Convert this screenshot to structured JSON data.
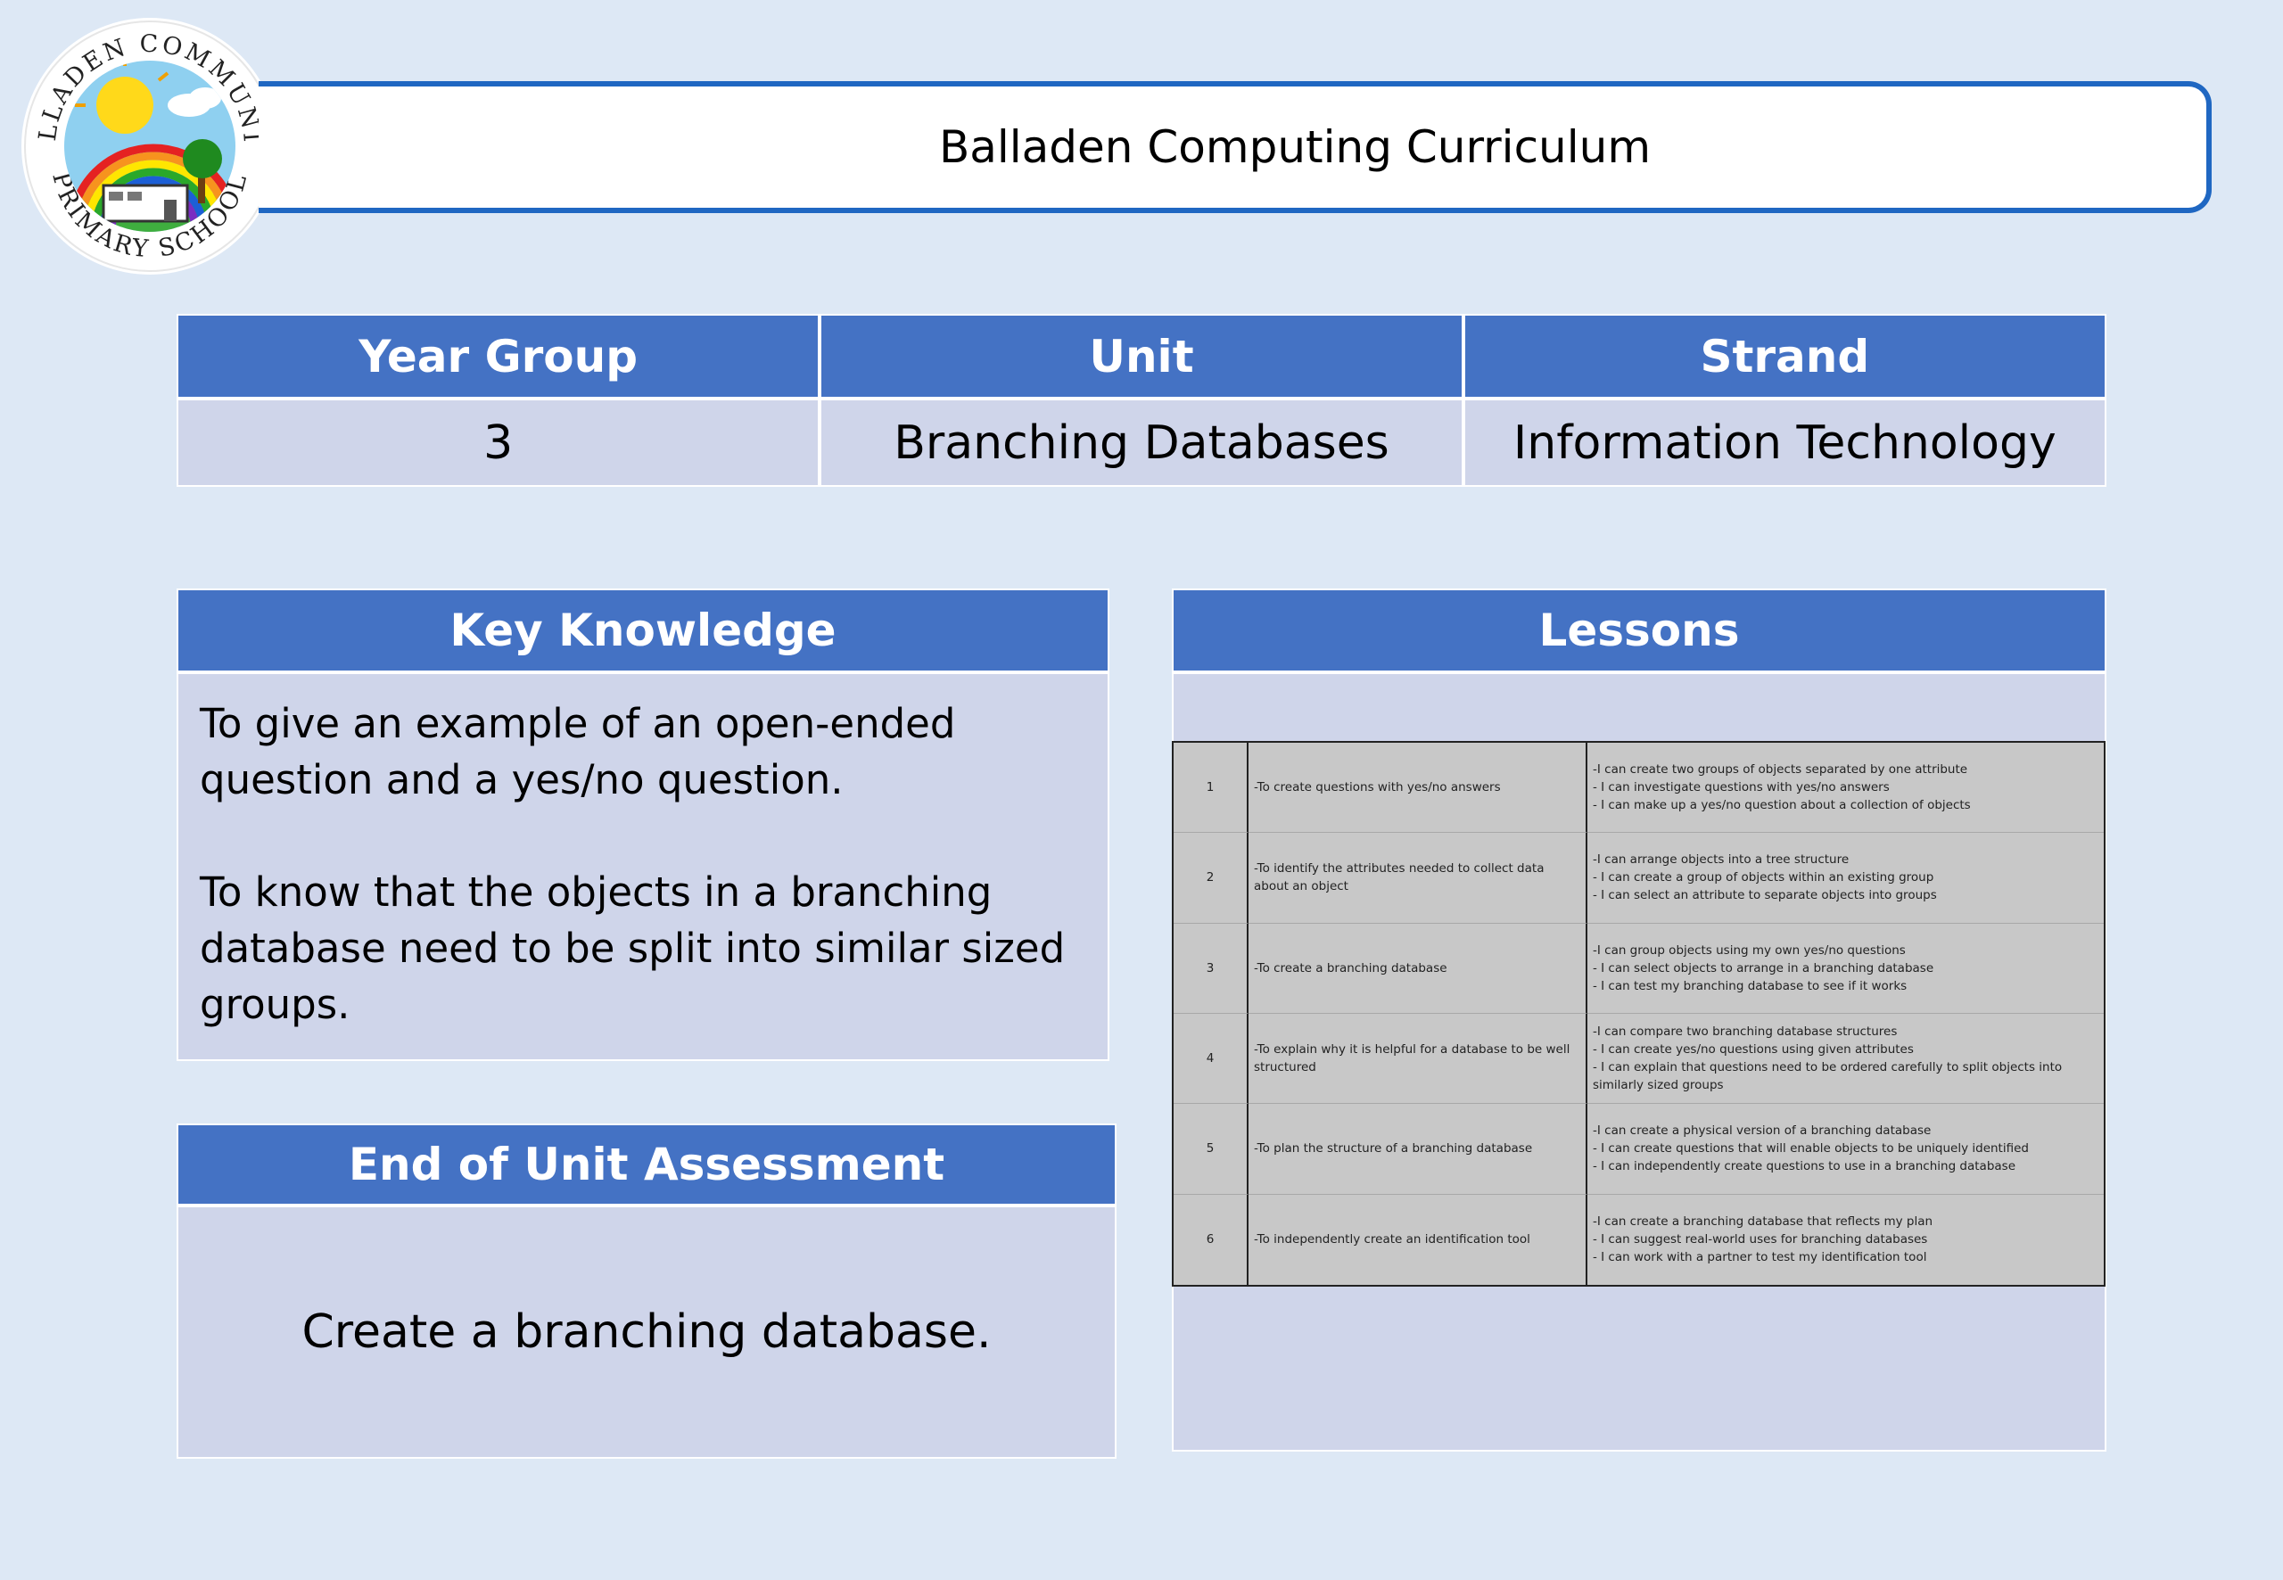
{
  "logo": {
    "arc_text_top": "BALLADEN COMMUNITY",
    "arc_text_bottom": "PRIMARY SCHOOL"
  },
  "title": "Balladen Computing Curriculum",
  "info_table": {
    "headers": [
      "Year Group",
      "Unit",
      "Strand"
    ],
    "values": [
      "3",
      "Branching Databases",
      "Information Technology"
    ]
  },
  "key_knowledge": {
    "heading": "Key Knowledge",
    "paragraphs": [
      "To give an example of an open-ended question and a yes/no question.",
      "To know that the objects in a branching database need to be split into similar sized groups."
    ]
  },
  "assessment": {
    "heading": "End of Unit Assessment",
    "text": "Create a branching database."
  },
  "lessons": {
    "heading": "Lessons",
    "rows": [
      {
        "num": "1",
        "objective": "-To create questions with yes/no answers",
        "outcomes": [
          "-I can create two groups of objects separated by one attribute",
          "- I can investigate questions with yes/no answers",
          "- I can make up a yes/no question about a collection of objects"
        ]
      },
      {
        "num": "2",
        "objective": "-To identify the attributes needed to collect data about an object",
        "outcomes": [
          "-I can arrange objects into a tree structure",
          "- I can create a group of objects within an existing group",
          "- I can select an attribute to separate objects into groups"
        ]
      },
      {
        "num": "3",
        "objective": "-To create a branching database",
        "outcomes": [
          "-I can group objects using my own yes/no questions",
          "- I can select objects to arrange in a branching database",
          "- I can test my branching database to see if it works"
        ]
      },
      {
        "num": "4",
        "objective": "-To explain why it is helpful for a database to be well structured",
        "outcomes": [
          "-I can compare two branching database structures",
          "- I can create yes/no questions using given attributes",
          "- I can explain that questions need to be ordered carefully to split objects into similarly sized groups"
        ]
      },
      {
        "num": "5",
        "objective": "-To plan the structure of a branching database",
        "outcomes": [
          "-I can create a physical version of a branching database",
          "- I can create questions that will enable objects to be uniquely identified",
          "- I can independently create questions to use in a branching database"
        ]
      },
      {
        "num": "6",
        "objective": "-To independently create an identification tool",
        "outcomes": [
          "-I can create a branching database that reflects my plan",
          "- I can suggest real-world uses for branching databases",
          "- I can work with a partner to test my identification tool"
        ]
      }
    ]
  }
}
